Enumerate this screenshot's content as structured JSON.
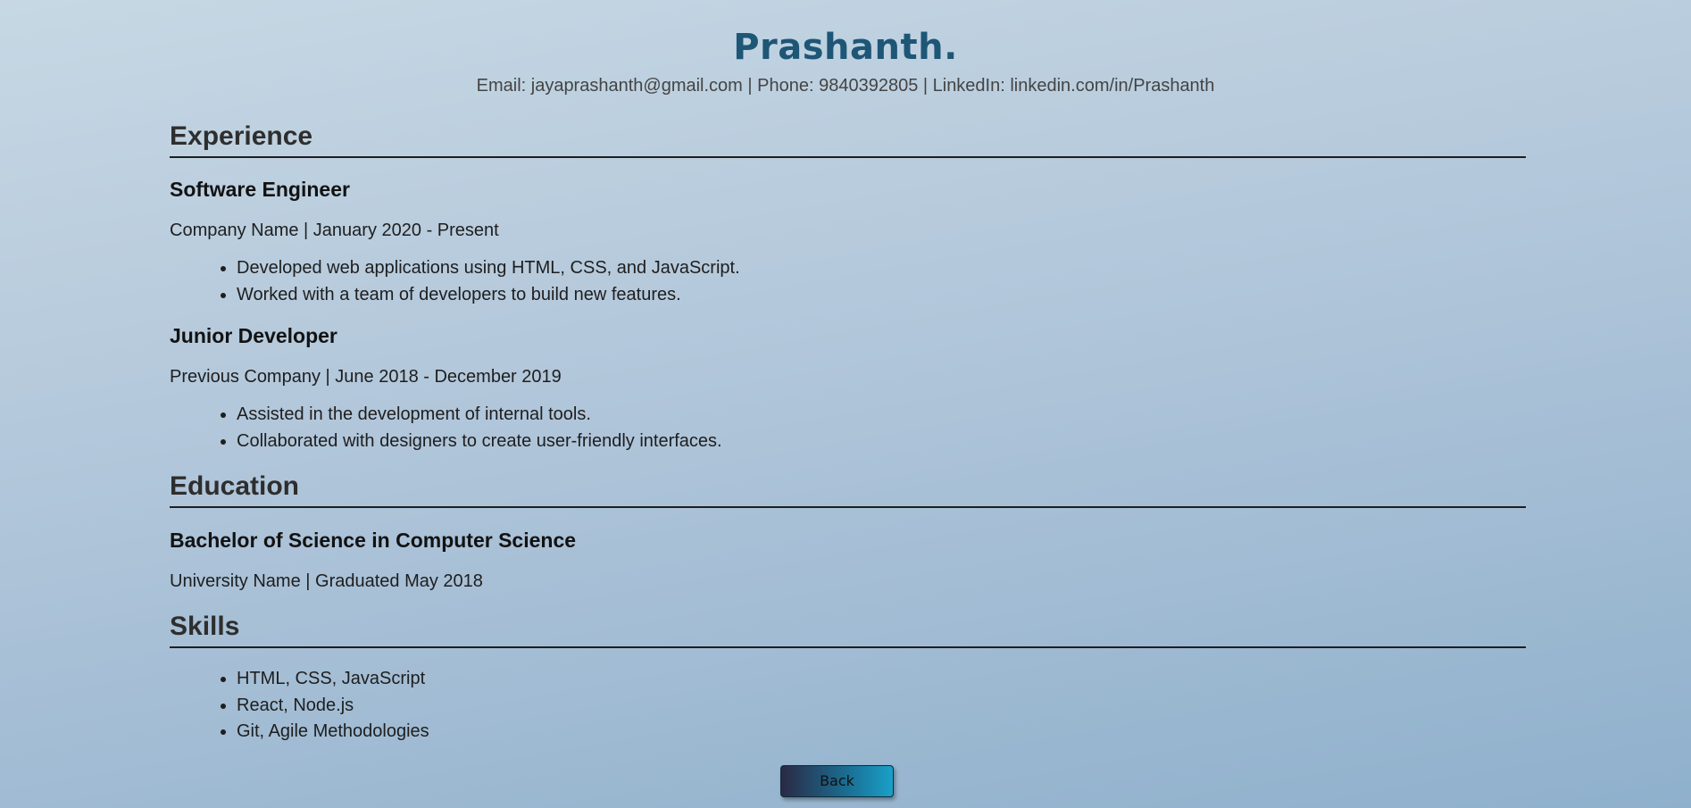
{
  "header": {
    "name": "Prashanth.",
    "contact": "Email: jayaprashanth@gmail.com | Phone: 9840392805 | LinkedIn: linkedin.com/in/Prashanth"
  },
  "experience": {
    "title": "Experience",
    "jobs": [
      {
        "title": "Software Engineer",
        "meta": "Company Name | January 2020 - Present",
        "bullets": [
          "Developed web applications using HTML, CSS, and JavaScript.",
          "Worked with a team of developers to build new features."
        ]
      },
      {
        "title": "Junior Developer",
        "meta": "Previous Company | June 2018 - December 2019",
        "bullets": [
          "Assisted in the development of internal tools.",
          "Collaborated with designers to create user-friendly interfaces."
        ]
      }
    ]
  },
  "education": {
    "title": "Education",
    "degree": "Bachelor of Science in Computer Science",
    "meta": "University Name | Graduated May 2018"
  },
  "skills": {
    "title": "Skills",
    "items": [
      "HTML, CSS, JavaScript",
      "React, Node.js",
      "Git, Agile Methodologies"
    ]
  },
  "footer": {
    "back_label": "Back"
  }
}
